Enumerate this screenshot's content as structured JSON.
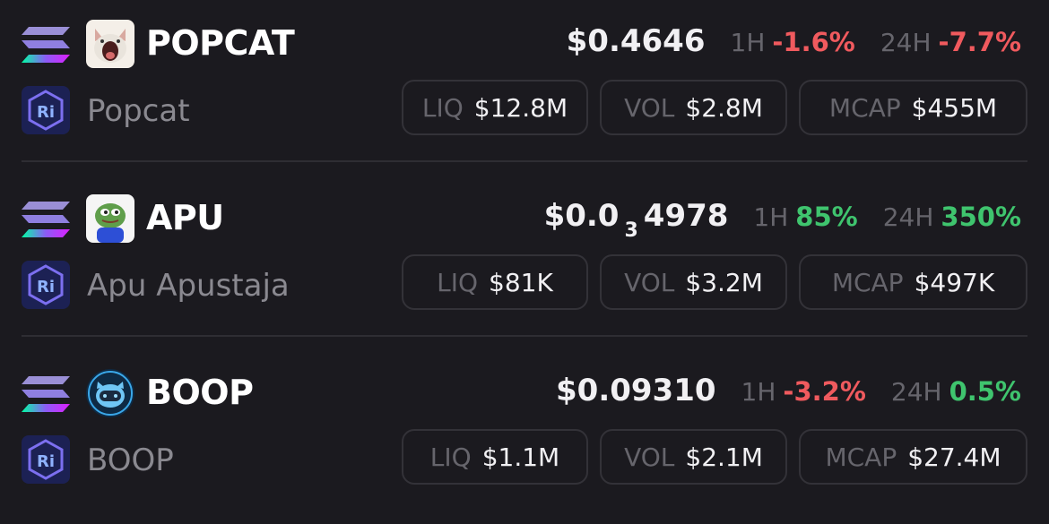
{
  "colors": {
    "background": "#1b1a1f",
    "negative": "#f05a5e",
    "positive": "#3fc46e",
    "muted": "#66656c",
    "divider": "#2e2d33"
  },
  "icons": {
    "chain": "solana-icon",
    "dex": "raydium-icon"
  },
  "tokens": [
    {
      "symbol": "POPCAT",
      "name": "Popcat",
      "avatar": "popcat-avatar-icon",
      "price": "$0.4646",
      "price_sub": "",
      "price_tail": "",
      "h1_label": "1H",
      "h1_change": "-1.6%",
      "h1_direction": "down",
      "h24_label": "24H",
      "h24_change": "-7.7%",
      "h24_direction": "down",
      "liq_label": "LIQ",
      "liq": "$12.8M",
      "vol_label": "VOL",
      "vol": "$2.8M",
      "mcap_label": "MCAP",
      "mcap": "$455M"
    },
    {
      "symbol": "APU",
      "name": "Apu Apustaja",
      "avatar": "apu-frog-avatar-icon",
      "price": "$0.0",
      "price_sub": "3",
      "price_tail": "4978",
      "h1_label": "1H",
      "h1_change": "85%",
      "h1_direction": "up",
      "h24_label": "24H",
      "h24_change": "350%",
      "h24_direction": "up",
      "liq_label": "LIQ",
      "liq": "$81K",
      "vol_label": "VOL",
      "vol": "$3.2M",
      "mcap_label": "MCAP",
      "mcap": "$497K"
    },
    {
      "symbol": "BOOP",
      "name": "BOOP",
      "avatar": "boop-avatar-icon",
      "price": "$0.09310",
      "price_sub": "",
      "price_tail": "",
      "h1_label": "1H",
      "h1_change": "-3.2%",
      "h1_direction": "down",
      "h24_label": "24H",
      "h24_change": "0.5%",
      "h24_direction": "up",
      "liq_label": "LIQ",
      "liq": "$1.1M",
      "vol_label": "VOL",
      "vol": "$2.1M",
      "mcap_label": "MCAP",
      "mcap": "$27.4M"
    }
  ]
}
